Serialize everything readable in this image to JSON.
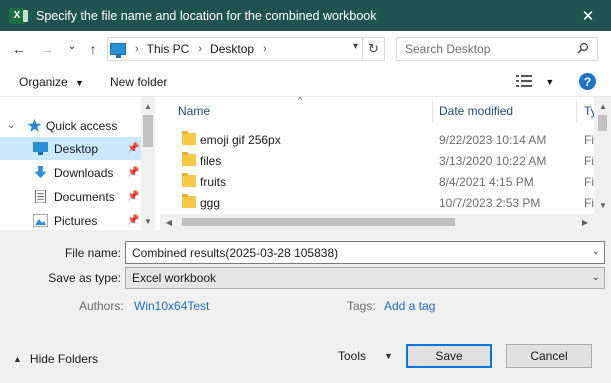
{
  "window": {
    "title": "Specify the file name and location for the combined workbook",
    "app_icon_letter": "X",
    "close_glyph": "✕"
  },
  "navbar": {
    "back_glyph": "←",
    "forward_glyph": "→",
    "recent_glyph": "⌄",
    "up_glyph": "↑",
    "breadcrumbs": [
      "This PC",
      "Desktop"
    ],
    "crumb_separator": "›",
    "refresh_glyph": "↻",
    "search_placeholder": "Search Desktop"
  },
  "toolbar": {
    "organize_label": "Organize",
    "new_folder_label": "New folder",
    "help_label": "?"
  },
  "nav_pane": {
    "items": [
      {
        "label": "Quick access",
        "icon": "star-icon",
        "expanded": true
      },
      {
        "label": "Desktop",
        "icon": "desktop-icon",
        "selected": true,
        "pinned": true
      },
      {
        "label": "Downloads",
        "icon": "download-icon",
        "pinned": true
      },
      {
        "label": "Documents",
        "icon": "documents-icon",
        "pinned": true
      },
      {
        "label": "Pictures",
        "icon": "pictures-icon",
        "pinned": true
      }
    ]
  },
  "file_list": {
    "columns": [
      "Name",
      "Date modified",
      "Ty"
    ],
    "rows": [
      {
        "name": "emoji gif 256px",
        "date": "9/22/2023 10:14 AM",
        "type": "Fi"
      },
      {
        "name": "files",
        "date": "3/13/2020 10:22 AM",
        "type": "Fi"
      },
      {
        "name": "fruits",
        "date": "8/4/2021 4:15 PM",
        "type": "Fi"
      },
      {
        "name": "ggg",
        "date": "10/7/2023 2:53 PM",
        "type": "Fi"
      }
    ]
  },
  "form": {
    "file_name_label": "File name:",
    "file_name_value": "Combined results(2025-03-28 105838)",
    "save_type_label": "Save as type:",
    "save_type_value": "Excel workbook",
    "authors_label": "Authors:",
    "authors_value": "Win10x64Test",
    "tags_label": "Tags:",
    "tags_value": "Add a tag"
  },
  "footer": {
    "hide_folders_label": "Hide Folders",
    "tools_label": "Tools",
    "save_label": "Save",
    "cancel_label": "Cancel"
  },
  "colors": {
    "titlebar": "#1f5350",
    "selection": "#cce8ff",
    "link": "#1e6dc2",
    "accent": "#0078d7",
    "folder": "#f7c948"
  }
}
